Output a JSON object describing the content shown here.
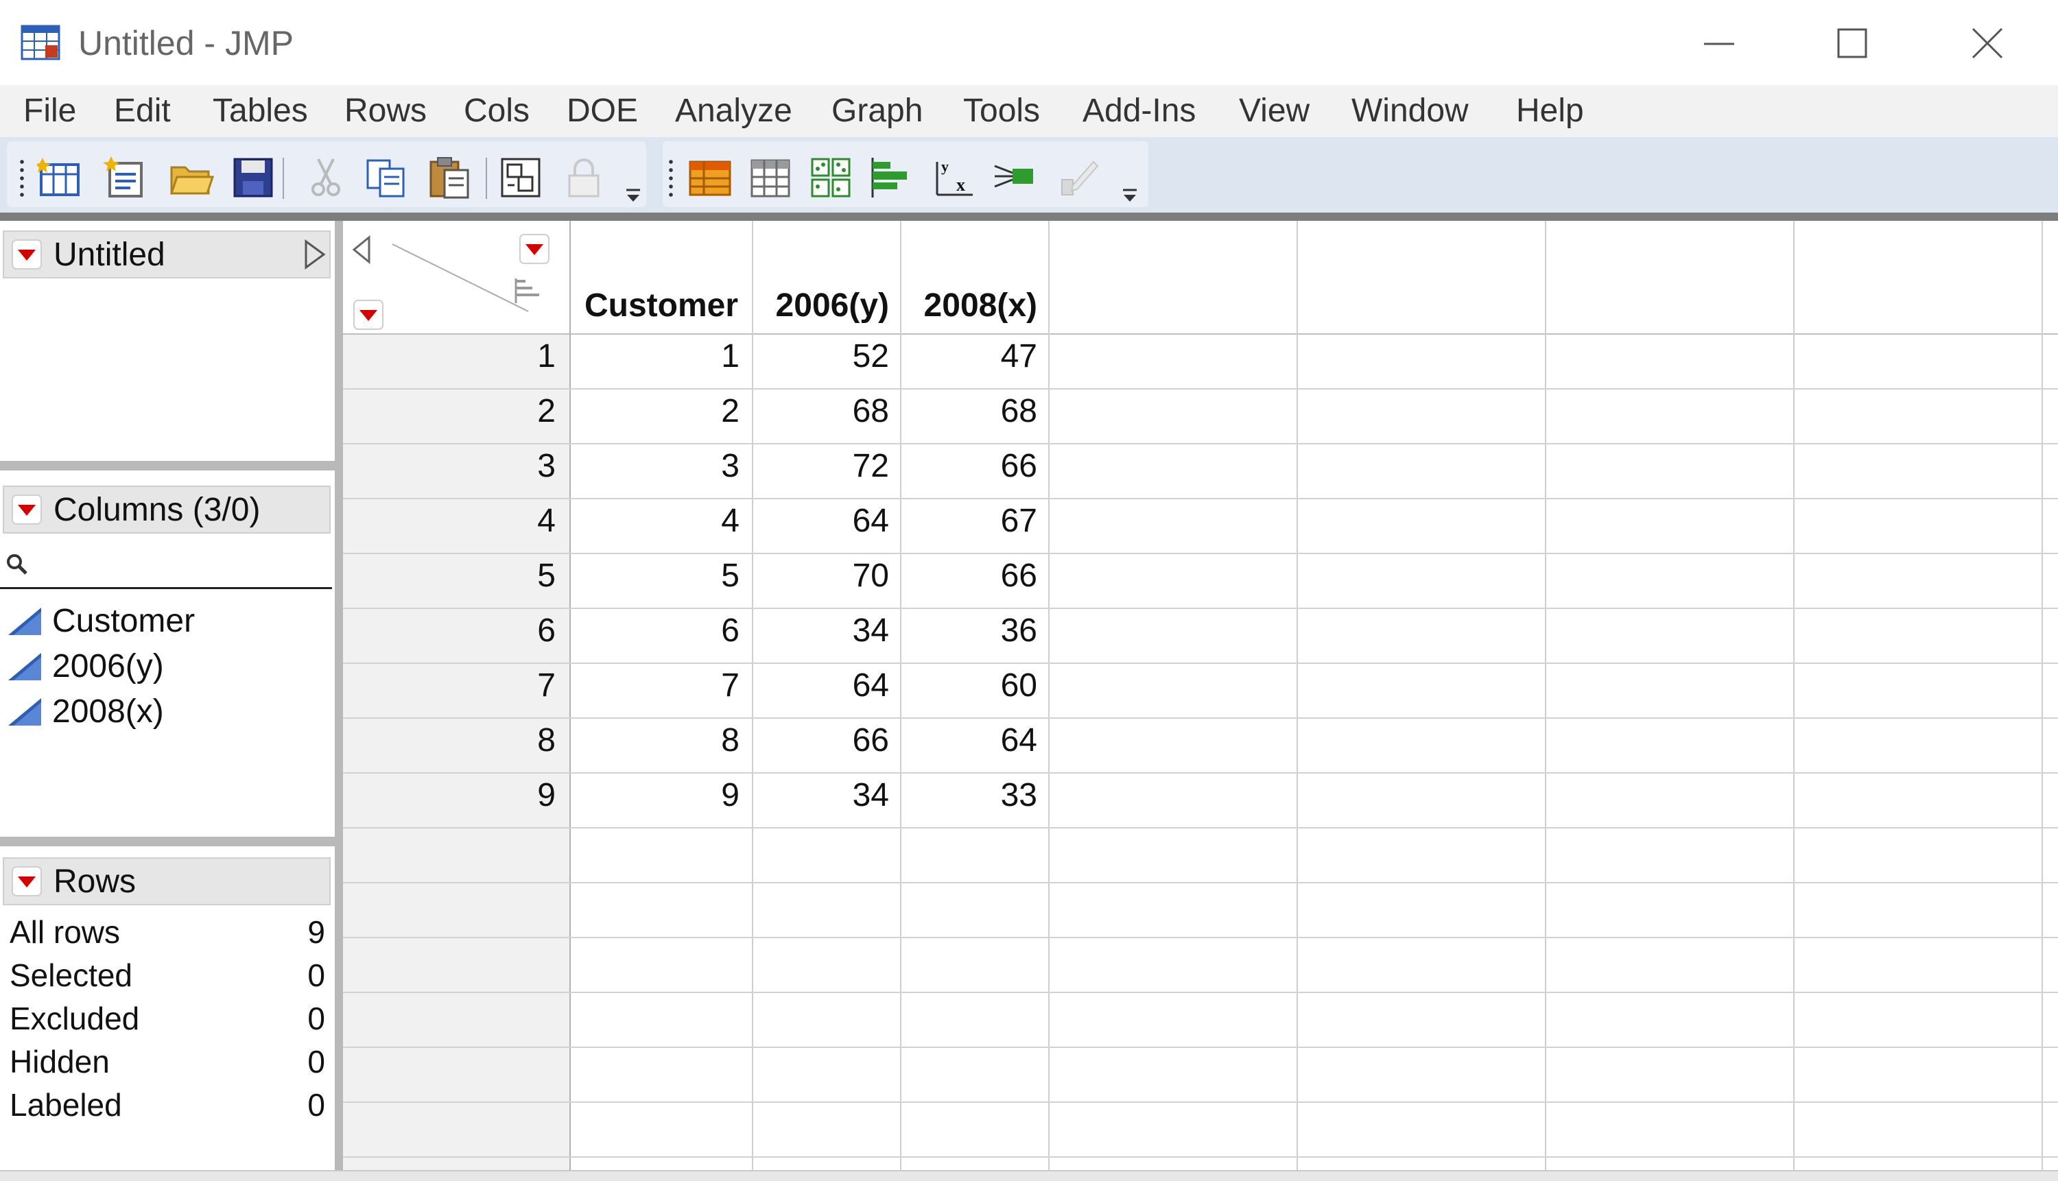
{
  "window": {
    "title": "Untitled - JMP"
  },
  "menu": [
    "File",
    "Edit",
    "Tables",
    "Rows",
    "Cols",
    "DOE",
    "Analyze",
    "Graph",
    "Tools",
    "Add-Ins",
    "View",
    "Window",
    "Help"
  ],
  "toolbar": {
    "file_icons": [
      "new-table-icon",
      "new-script-icon",
      "open-icon",
      "save-icon"
    ],
    "edit_icons": [
      "cut-icon",
      "copy-icon",
      "paste-icon"
    ],
    "other_icons": [
      "journal-icon",
      "lock-icon"
    ],
    "analysis_icons": [
      "data-table-icon",
      "summary-icon",
      "scatterplot-matrix-icon",
      "distribution-icon",
      "fit-y-by-x-icon",
      "fit-model-icon",
      "graph-builder-icon"
    ]
  },
  "table_panel": {
    "title": "Untitled"
  },
  "columns_panel": {
    "title": "Columns (3/0)",
    "columns": [
      "Customer",
      "2006(y)",
      "2008(x)"
    ]
  },
  "rows_panel": {
    "title": "Rows",
    "stats": [
      {
        "label": "All rows",
        "value": "9"
      },
      {
        "label": "Selected",
        "value": "0"
      },
      {
        "label": "Excluded",
        "value": "0"
      },
      {
        "label": "Hidden",
        "value": "0"
      },
      {
        "label": "Labeled",
        "value": "0"
      }
    ]
  },
  "table": {
    "headers": [
      "Customer",
      "2006(y)",
      "2008(x)"
    ],
    "rows": [
      {
        "n": "1",
        "c": "1",
        "y": "52",
        "x": "47"
      },
      {
        "n": "2",
        "c": "2",
        "y": "68",
        "x": "68"
      },
      {
        "n": "3",
        "c": "3",
        "y": "72",
        "x": "66"
      },
      {
        "n": "4",
        "c": "4",
        "y": "64",
        "x": "67"
      },
      {
        "n": "5",
        "c": "5",
        "y": "70",
        "x": "66"
      },
      {
        "n": "6",
        "c": "6",
        "y": "34",
        "x": "36"
      },
      {
        "n": "7",
        "c": "7",
        "y": "64",
        "x": "60"
      },
      {
        "n": "8",
        "c": "8",
        "y": "66",
        "x": "64"
      },
      {
        "n": "9",
        "c": "9",
        "y": "34",
        "x": "33"
      }
    ]
  },
  "colors": {
    "accent_red": "#d40000",
    "column_icon_blue": "#2b5fb8"
  }
}
